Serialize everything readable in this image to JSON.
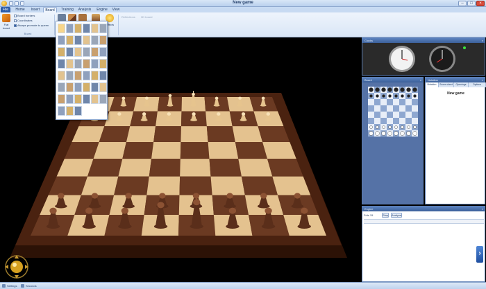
{
  "window": {
    "title": "New game"
  },
  "tabs": [
    "File",
    "Home",
    "Insert",
    "Board",
    "Training",
    "Analysis",
    "Engine",
    "View"
  ],
  "active_tab": "Board",
  "ribbon": {
    "flat_board_label": "Flat board",
    "checkboxes": [
      "Board borders",
      "Coordinates",
      "Always promote to queen"
    ],
    "group_board": "Board",
    "piece_buttons": [
      "Pieces",
      "Board",
      "Slides"
    ],
    "button_3d": "3D board",
    "effects_label": "Effects",
    "dim_items": [
      "Reflections",
      "3D board"
    ]
  },
  "panels": {
    "clocks_title": "Clocks",
    "board_title": "Board",
    "notation_title": "Notation",
    "notation_tabs": [
      "Notation",
      "Score sheet",
      "Openings",
      "Options"
    ],
    "game_title": "New game",
    "engine_title": "Engine",
    "engine_label": "Fritz 15",
    "engine_buttons": [
      "Stop",
      "Analyze"
    ]
  },
  "status": {
    "items": [
      "Settings",
      "Seconds"
    ]
  },
  "colors": {
    "ribbon_bg": "#dfeaf7",
    "accent": "#2b5ca8",
    "board_light": "#e4c28f",
    "board_dark": "#6b3a22",
    "frame": "#4a2210"
  }
}
